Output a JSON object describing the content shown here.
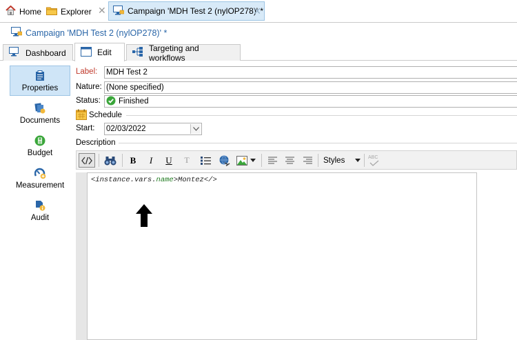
{
  "tabs": {
    "home": "Home",
    "explorer": "Explorer",
    "campaign": "Campaign 'MDH Test 2 (nylOP278)' *",
    "close_glyph": "✕"
  },
  "window_title": "Campaign 'MDH Test 2 (nylOP278)' *",
  "subtabs": {
    "dashboard": "Dashboard",
    "edit": "Edit",
    "targeting": "Targeting and workflows"
  },
  "sidebar": {
    "items": [
      {
        "label": "Properties",
        "icon": "clipboard-icon",
        "selected": true
      },
      {
        "label": "Documents",
        "icon": "documents-icon"
      },
      {
        "label": "Budget",
        "icon": "calculator-icon"
      },
      {
        "label": "Measurement",
        "icon": "gauge-icon"
      },
      {
        "label": "Audit",
        "icon": "audit-icon"
      }
    ]
  },
  "form": {
    "label_label": "Label:",
    "label_value": "MDH Test 2",
    "nature_label": "Nature:",
    "nature_value": "(None specified)",
    "status_label": "Status:",
    "status_value": "Finished",
    "schedule_heading": "Schedule",
    "start_label": "Start:",
    "start_value": "02/03/2022",
    "description_heading": "Description"
  },
  "toolbar": {
    "bold": "B",
    "italic": "I",
    "underline": "U",
    "clear_format": "T",
    "styles": "Styles",
    "spell": "ABC"
  },
  "editor": {
    "code_open": "<instance.vars.",
    "code_var": "name",
    "code_close": ">Montez</>"
  },
  "colors": {
    "accent_blue": "#2a66a8",
    "label_red": "#c0392b",
    "selected_bg": "#cfe5f7",
    "status_green": "#3aa63a"
  }
}
